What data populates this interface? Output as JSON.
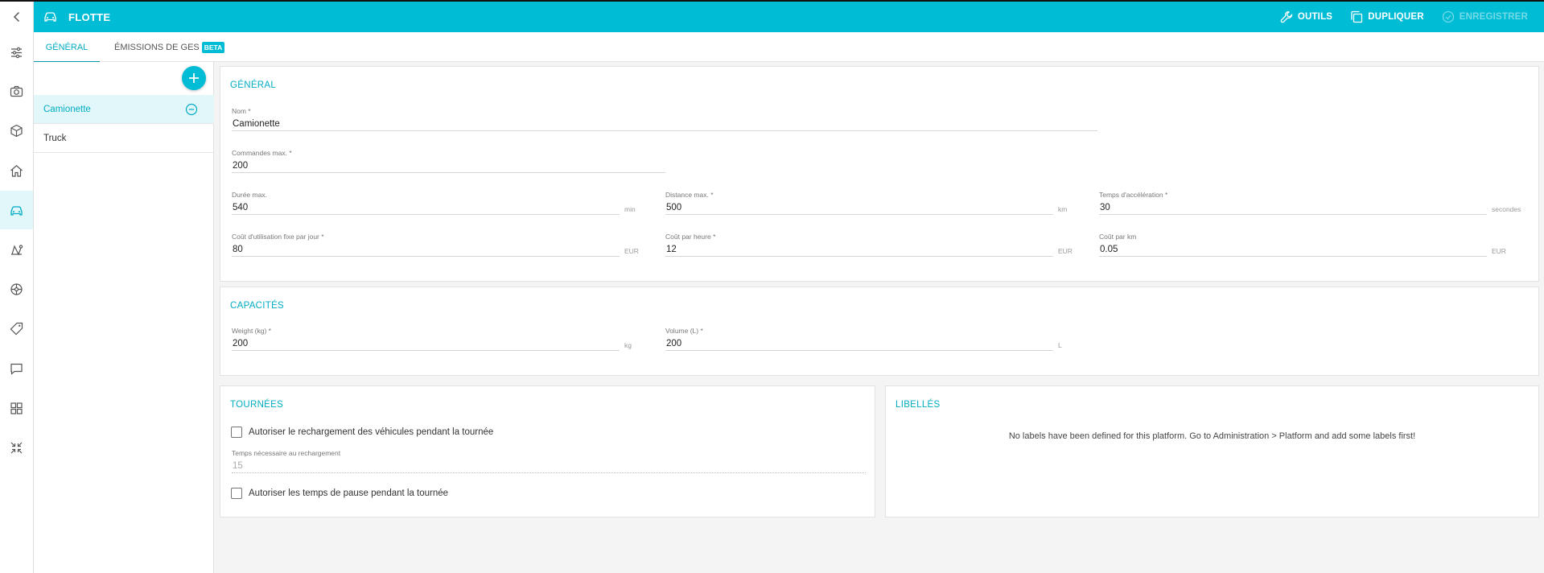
{
  "header": {
    "title": "FLOTTE",
    "actions": {
      "tools": "OUTILS",
      "duplicate": "DUPLIQUER",
      "save": "ENREGISTRER"
    }
  },
  "rail": {
    "items": [
      "settings-sliders-icon",
      "camera-icon",
      "cube-icon",
      "home-icon",
      "car-icon",
      "route-icon",
      "wheel-icon",
      "tag-icon",
      "chat-icon",
      "grid-icon",
      "compress-icon"
    ],
    "active": "car-icon"
  },
  "tabs": [
    {
      "label": "GÉNÉRAL",
      "active": true
    },
    {
      "label": "ÉMISSIONS DE GES",
      "badge": "BETA"
    }
  ],
  "vehicles": [
    {
      "name": "Camionette",
      "selected": true
    },
    {
      "name": "Truck"
    }
  ],
  "general": {
    "title": "GÉNÉRAL",
    "nom": {
      "label": "Nom *",
      "value": "Camionette"
    },
    "commandes_max": {
      "label": "Commandes max. *",
      "value": "200"
    },
    "duree_max": {
      "label": "Durée max.",
      "value": "540",
      "unit": "min"
    },
    "distance_max": {
      "label": "Distance max. *",
      "value": "500",
      "unit": "km"
    },
    "temps_acceleration": {
      "label": "Temps d'accélération *",
      "value": "30",
      "unit": "secondes"
    },
    "cout_fixe": {
      "label": "Coût d'utilisation fixe par jour *",
      "value": "80",
      "unit": "EUR"
    },
    "cout_heure": {
      "label": "Coût par heure *",
      "value": "12",
      "unit": "EUR"
    },
    "cout_km": {
      "label": "Coût par km",
      "value": "0.05",
      "unit": "EUR"
    }
  },
  "capacites": {
    "title": "CAPACITÉS",
    "weight": {
      "label": "Weight (kg) *",
      "value": "200",
      "unit": "kg"
    },
    "volume": {
      "label": "Volume (L) *",
      "value": "200",
      "unit": "L"
    }
  },
  "tournees": {
    "title": "TOURNÉES",
    "recharge_label": "Autoriser le rechargement des véhicules pendant la tournée",
    "temps_recharge": {
      "label": "Temps nécessaire au rechargement",
      "value": "15"
    },
    "pause_label": "Autoriser les temps de pause pendant la tournée"
  },
  "libelles": {
    "title": "LIBELLÉS",
    "empty": "No labels have been defined for this platform. Go to Administration > Platform and add some labels first!"
  },
  "colors": {
    "accent": "#00bcd4",
    "accent_text": "#00acc1"
  }
}
